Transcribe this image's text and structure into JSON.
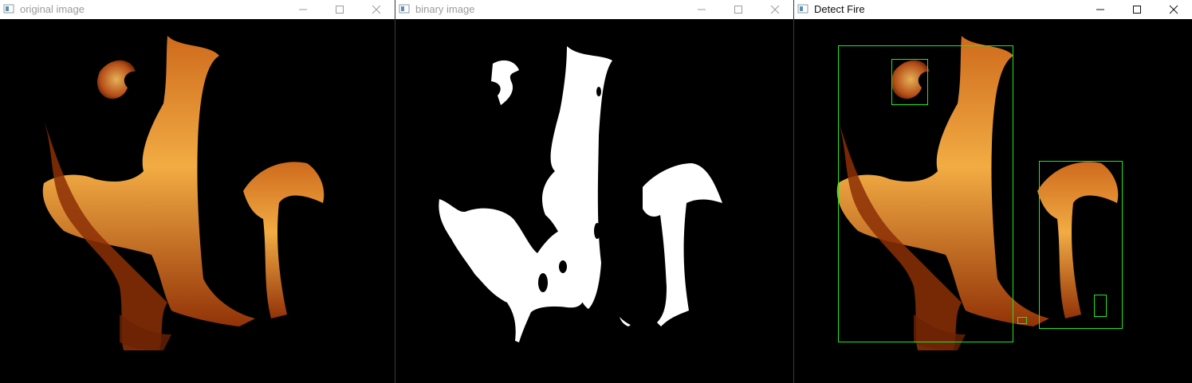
{
  "windows": [
    {
      "title": "original image",
      "state": "inactive"
    },
    {
      "title": "binary image",
      "state": "inactive"
    },
    {
      "title": "Detect Fire",
      "state": "active"
    }
  ],
  "controls": {
    "minimize_icon": "minimize-icon",
    "maximize_icon": "maximize-icon",
    "close_icon": "close-icon"
  },
  "colors": {
    "box": "#22e722",
    "flame_core": "#ffb547",
    "flame_edge": "#b3400a",
    "mask": "#ffffff"
  },
  "detections_count": 5
}
